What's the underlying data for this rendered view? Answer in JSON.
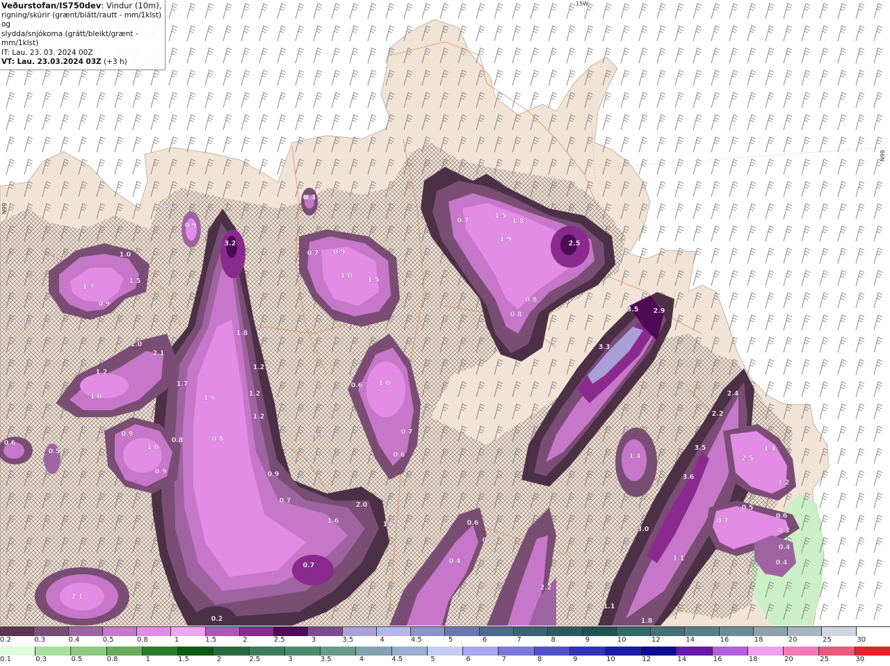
{
  "info": {
    "source": "Veðurstofan/IS750dev",
    "line1_rest": ": Vindur (10m),",
    "line2": "rigning/skúrir (grænt/blátt/rautt - mm/1klst) og",
    "line3": "slydda/snjókoma (grátt/bleikt/grænt - mm/1klst)",
    "it_line": "IT: Lau. 23. 03. 2024 00Z",
    "vt_line": "VT: Lau. 23.03.2024 03Z",
    "vt_offset": "(+3 h)"
  },
  "coords": {
    "top": "15W",
    "right": "N99",
    "left": "N99"
  },
  "legend_snow": {
    "labels": [
      "0.2",
      "0.3",
      "0.4",
      "0.5",
      "0.8",
      "1",
      "1.5",
      "2",
      "2.5",
      "3",
      "3.5",
      "4",
      "4.5",
      "5",
      "6",
      "7",
      "8",
      "9",
      "10",
      "12",
      "14",
      "16",
      "18",
      "20",
      "25",
      "30"
    ],
    "colors": [
      "#5a3550",
      "#7a4d74",
      "#a063a2",
      "#c777c9",
      "#e38ce6",
      "#f0a5f3",
      "#b255b7",
      "#8a2a8e",
      "#4e0a55",
      "#7d4c8c",
      "#a9a0d8",
      "#b6b6ea",
      "#8d92cc",
      "#6a76b0",
      "#4d6a8a",
      "#3b6272",
      "#2c5a62",
      "#1f5052",
      "#2f6a6a",
      "#466f77",
      "#587f88",
      "#6b8d96",
      "#8ca2ad",
      "#a7b6c1",
      "#d0d7de",
      "#ffffff"
    ]
  },
  "legend_rain": {
    "labels": [
      "0.1",
      "0.3",
      "0.5",
      "0.8",
      "1",
      "1.5",
      "2",
      "2.5",
      "3",
      "3.5",
      "4",
      "4.5",
      "5",
      "6",
      "7",
      "8",
      "9",
      "10",
      "12",
      "14",
      "16",
      "18",
      "20",
      "25",
      "30"
    ],
    "colors": [
      "#dcfadc",
      "#a8e0a0",
      "#8cc87e",
      "#6aaa5c",
      "#2f7a2c",
      "#0d5a14",
      "#2a6a40",
      "#3c7c5c",
      "#4e8a70",
      "#6a9a8a",
      "#82a2b2",
      "#9aaed0",
      "#c8ccf4",
      "#a8a6ec",
      "#7c78dc",
      "#5452c8",
      "#3434b8",
      "#1a1aa6",
      "#0c0c94",
      "#6a1aa8",
      "#b060d8",
      "#f0a0ea",
      "#f47ab8",
      "#e85a7a",
      "#e8242a"
    ]
  },
  "cell_values": [
    "3.2",
    "1.0",
    "1.7",
    "1.5",
    "1.7",
    "0.9",
    "0.9",
    "0.8",
    "0.3",
    "0.4",
    "0.7",
    "0.9",
    "1.0",
    "1.5",
    "0.7",
    "1.5",
    "1.8",
    "1.9",
    "2.5",
    "0.8",
    "0.8",
    "1.0",
    "2.1",
    "1.2",
    "1.0",
    "1.8",
    "1.7",
    "1.6",
    "1.2",
    "1.2",
    "1.2",
    "0.6",
    "0.5",
    "0.9",
    "1.0",
    "0.8",
    "0.8",
    "0.9",
    "0.4",
    "0.6",
    "1.0",
    "0.7",
    "0.6",
    "0.3",
    "0.9",
    "0.7",
    "3.5",
    "2.9",
    "3.3",
    "1.4",
    "2.4",
    "2.2",
    "3.5",
    "2.5",
    "1.4",
    "1.2",
    "3.6",
    "0.5",
    "0.6",
    "0.7",
    "0.3",
    "0.4",
    "0.4",
    "1.6",
    "1.1",
    "3.0",
    "2.0",
    "1.6",
    "0.6",
    "0.4",
    "0.4",
    "0.7",
    "2.1",
    "0.2",
    "2.2",
    "1.1",
    "1.8",
    "0.5"
  ]
}
